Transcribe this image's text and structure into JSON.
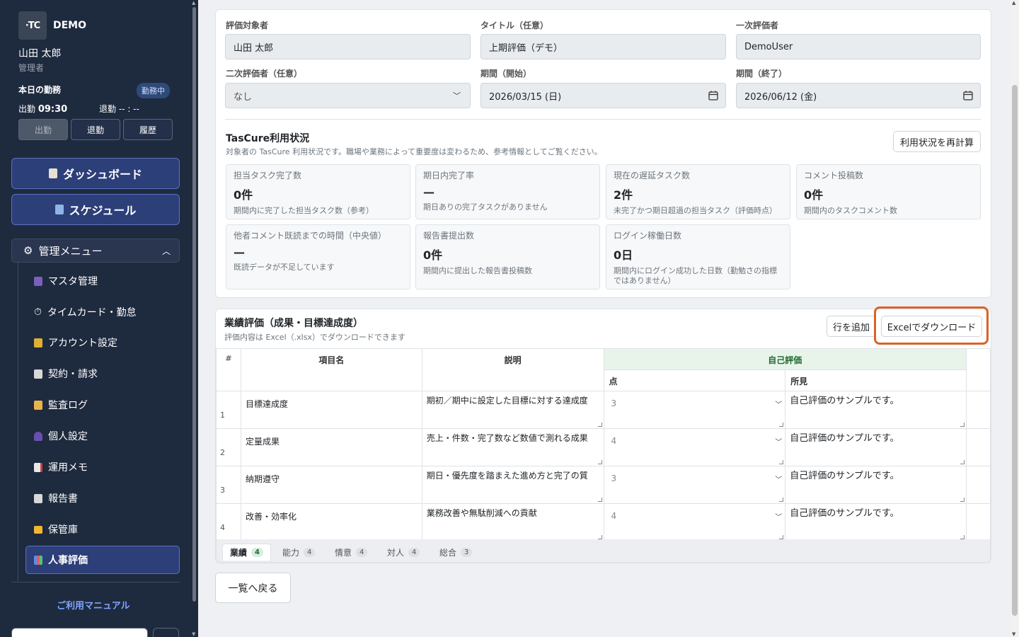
{
  "sidebar": {
    "logo": "·TC",
    "brand": "DEMO",
    "user_name": "山田 太郎",
    "user_role": "管理者",
    "attendance_title": "本日の勤務",
    "status_badge": "勤務中",
    "clock_in_label": "出勤",
    "clock_in_time": "09:30",
    "clock_out_label": "退勤",
    "clock_out_time": "-- : --",
    "btn_in": "出勤",
    "btn_out": "退勤",
    "btn_history": "履歴",
    "dashboard": "ダッシュボード",
    "schedule": "スケジュール",
    "admin_menu": "管理メニュー",
    "menu": [
      "マスタ管理",
      "タイムカード・勤怠",
      "アカウント設定",
      "契約・請求",
      "監査ログ",
      "個人設定",
      "運用メモ",
      "報告書",
      "保管庫",
      "人事評価"
    ],
    "manual": "ご利用マニュアル"
  },
  "form": {
    "target_label": "評価対象者",
    "target_value": "山田 太郎",
    "title_label": "タイトル（任意）",
    "title_value": "上期評価（デモ）",
    "first_label": "一次評価者",
    "first_value": "DemoUser",
    "second_label": "二次評価者（任意）",
    "second_value": "なし",
    "start_label": "期間（開始）",
    "start_value": "2026/03/15 (日)",
    "end_label": "期間（終了）",
    "end_value": "2026/06/12 (金)"
  },
  "usage": {
    "title": "TasCure利用状況",
    "subtitle": "対象者の TasCure 利用状況です。職場や業務によって重要度は変わるため、参考情報としてご覧ください。",
    "recalc": "利用状況を再計算",
    "stats": [
      {
        "t": "担当タスク完了数",
        "v": "0件",
        "d": "期間内に完了した担当タスク数（参考）"
      },
      {
        "t": "期日内完了率",
        "v": "—",
        "d": "期日ありの完了タスクがありません"
      },
      {
        "t": "現在の遅延タスク数",
        "v": "2件",
        "d": "未完了かつ期日超過の担当タスク（評価時点）"
      },
      {
        "t": "コメント投稿数",
        "v": "0件",
        "d": "期間内のタスクコメント数"
      },
      {
        "t": "他者コメント既読までの時間（中央値）",
        "v": "—",
        "d": "既読データが不足しています"
      },
      {
        "t": "報告書提出数",
        "v": "0件",
        "d": "期間内に提出した報告書投稿数"
      },
      {
        "t": "ログイン稼働日数",
        "v": "0日",
        "d": "期間内にログイン成功した日数（勤勉さの指標ではありません）"
      }
    ]
  },
  "perf": {
    "title": "業績評価（成果・目標達成度）",
    "subtitle": "評価内容は Excel（.xlsx）でダウンロードできます",
    "add_row": "行を追加",
    "download": "Excelでダウンロード",
    "col_num": "#",
    "col_item": "項目名",
    "col_desc": "説明",
    "col_self": "自己評価",
    "col_score": "点",
    "col_comment": "所見",
    "rows": [
      {
        "n": "1",
        "item": "目標達成度",
        "desc": "期初／期中に設定した目標に対する達成度",
        "score": "3",
        "comment": "自己評価のサンプルです。"
      },
      {
        "n": "2",
        "item": "定量成果",
        "desc": "売上・件数・完了数など数値で測れる成果",
        "score": "4",
        "comment": "自己評価のサンプルです。"
      },
      {
        "n": "3",
        "item": "納期遵守",
        "desc": "期日・優先度を踏まえた進め方と完了の質",
        "score": "3",
        "comment": "自己評価のサンプルです。"
      },
      {
        "n": "4",
        "item": "改善・効率化",
        "desc": "業務改善や無駄削減への貢献",
        "score": "4",
        "comment": "自己評価のサンプルです。"
      }
    ],
    "tabs": [
      {
        "label": "業績",
        "n": "4"
      },
      {
        "label": "能力",
        "n": "4"
      },
      {
        "label": "情意",
        "n": "4"
      },
      {
        "label": "対人",
        "n": "4"
      },
      {
        "label": "総合",
        "n": "3"
      }
    ]
  },
  "back": "一覧へ戻る"
}
